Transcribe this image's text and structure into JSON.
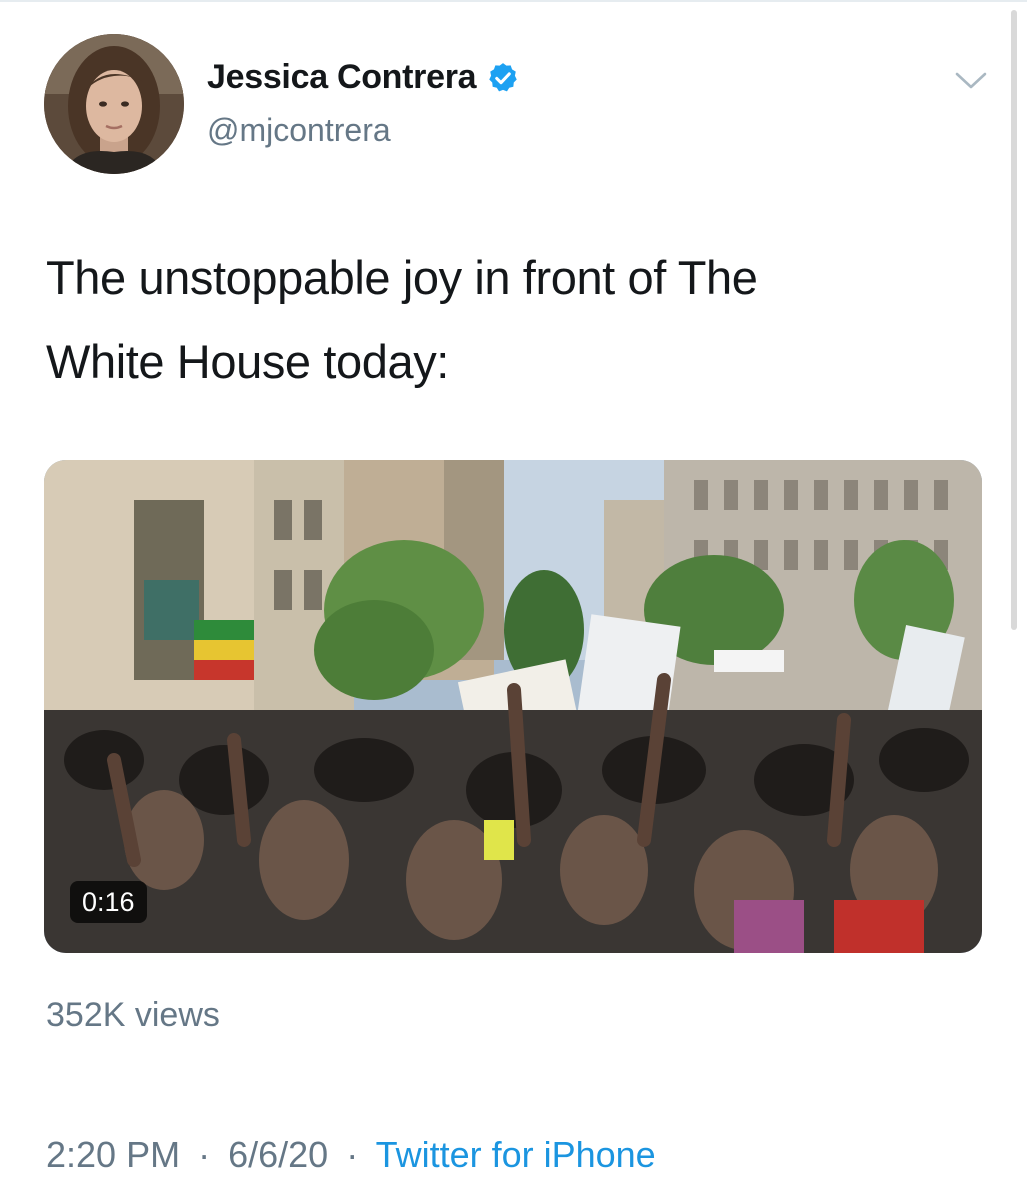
{
  "tweet": {
    "display_name": "Jessica Contrera",
    "handle": "@mjcontrera",
    "text_line1": "The unstoppable joy in front of The",
    "text_line2": "White House today:",
    "video_duration": "0:16",
    "views": "352K views",
    "time": "2:20 PM",
    "date": "6/6/20",
    "separator": "·",
    "source": "Twitter for iPhone"
  },
  "icons": {
    "verified": "verified-badge-icon",
    "caret": "chevron-down-icon"
  },
  "colors": {
    "verified": "#1da1f2",
    "link": "#1b95e0",
    "secondary_text": "#657786",
    "primary_text": "#14171a"
  }
}
